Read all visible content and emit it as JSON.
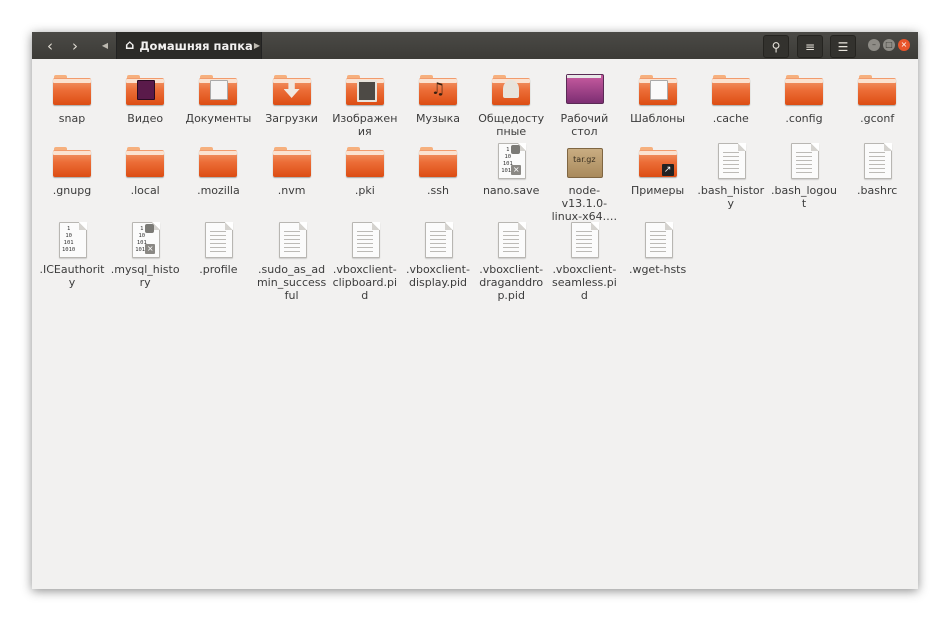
{
  "window": {
    "path_label": "Домашняя папка",
    "icons": {
      "back": "chevron-left-icon",
      "forward": "chevron-right-icon",
      "home": "home-icon",
      "search": "search-icon",
      "view": "view-options-icon",
      "menu": "menu-icon"
    }
  },
  "colors": {
    "titlebar": "#3c3b37",
    "folder": "#e8632b",
    "close": "#e9552b",
    "background": "#f2f1f0"
  },
  "items": [
    {
      "label": "snap",
      "type": "folder"
    },
    {
      "label": "Видео",
      "type": "folder-video"
    },
    {
      "label": "Документы",
      "type": "folder-documents"
    },
    {
      "label": "Загрузки",
      "type": "folder-downloads"
    },
    {
      "label": "Изображения",
      "type": "folder-pictures"
    },
    {
      "label": "Музыка",
      "type": "folder-music"
    },
    {
      "label": "Общедоступные",
      "type": "folder-public"
    },
    {
      "label": "Рабочий стол",
      "type": "desktop"
    },
    {
      "label": "Шаблоны",
      "type": "folder-templates"
    },
    {
      "label": ".cache",
      "type": "folder"
    },
    {
      "label": ".config",
      "type": "folder"
    },
    {
      "label": ".gconf",
      "type": "folder"
    },
    {
      "label": ".gnupg",
      "type": "folder"
    },
    {
      "label": ".local",
      "type": "folder"
    },
    {
      "label": ".mozilla",
      "type": "folder"
    },
    {
      "label": ".nvm",
      "type": "folder"
    },
    {
      "label": ".pki",
      "type": "folder"
    },
    {
      "label": ".ssh",
      "type": "folder"
    },
    {
      "label": "nano.save",
      "type": "binary"
    },
    {
      "label": "node-v13.1.0-linux-x64.…",
      "type": "archive",
      "archive_text": "tar.gz"
    },
    {
      "label": "Примеры",
      "type": "folder-link"
    },
    {
      "label": ".bash_history",
      "type": "document"
    },
    {
      "label": ".bash_logout",
      "type": "document"
    },
    {
      "label": ".bashrc",
      "type": "document"
    },
    {
      "label": ".ICEauthority",
      "type": "binary-plain"
    },
    {
      "label": ".mysql_history",
      "type": "binary"
    },
    {
      "label": ".profile",
      "type": "document"
    },
    {
      "label": ".sudo_as_admin_successful",
      "type": "document"
    },
    {
      "label": ".vboxclient-clipboard.pid",
      "type": "document"
    },
    {
      "label": ".vboxclient-display.pid",
      "type": "document"
    },
    {
      "label": ".vboxclient-draganddrop.pid",
      "type": "document"
    },
    {
      "label": ".vboxclient-seamless.pid",
      "type": "document"
    },
    {
      "label": ".wget-hsts",
      "type": "document"
    }
  ]
}
